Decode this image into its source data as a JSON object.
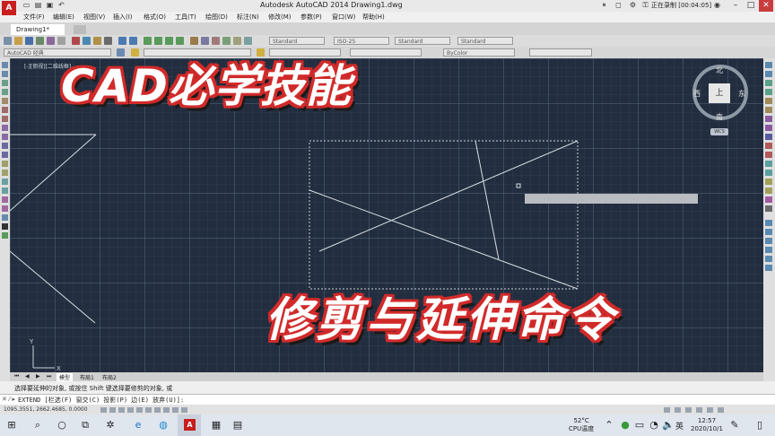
{
  "window": {
    "title": "Autodesk AutoCAD 2014    Drawing1.dwg",
    "app_logo": "A",
    "recording_status": "正在录制 [00:04:05]"
  },
  "menu": [
    "文件(F)",
    "编辑(E)",
    "视图(V)",
    "插入(I)",
    "格式(O)",
    "工具(T)",
    "绘图(D)",
    "标注(N)",
    "修改(M)",
    "参数(P)",
    "窗口(W)",
    "帮助(H)"
  ],
  "tabs": {
    "document": "Drawing1*"
  },
  "toolbars": {
    "text_style": "Standard",
    "dim_style": "ISO-25",
    "table_style": "Standard",
    "multileader_style": "Standard",
    "workspace": "AutoCAD 经典",
    "linetype": "ByColor"
  },
  "canvas": {
    "viewport_label": "[-][俯视][二维线框]"
  },
  "overlay": {
    "headline": "CAD必学技能",
    "subtitle": "修剪与延伸命令"
  },
  "viewcube": {
    "north": "北",
    "south": "南",
    "east": "东",
    "west": "西",
    "face": "上",
    "wcs": "WCS"
  },
  "layout_tabs": [
    "模型",
    "布局1",
    "布局2"
  ],
  "command": {
    "history": "选择要延伸的对象, 或按住 Shift 键选择要修剪的对象, 或",
    "prefix": "✕ ⁄ ▸",
    "prompt": "EXTEND [栏选(F) 窗交(C) 投影(P) 边(E) 放弃(U)]:"
  },
  "status": {
    "coords": "1095.3551, 2662.4685, 0.0000"
  },
  "taskbar": {
    "weather_temp": "52°C",
    "weather_label": "CPU温度",
    "ime": "英",
    "time": "12:57",
    "date": "2020/10/1"
  },
  "colors": {
    "canvas": "#222e3f",
    "title_outline": "#d12a2a",
    "title_fill": "#ffffff",
    "autocad_red": "#c81e1e"
  }
}
